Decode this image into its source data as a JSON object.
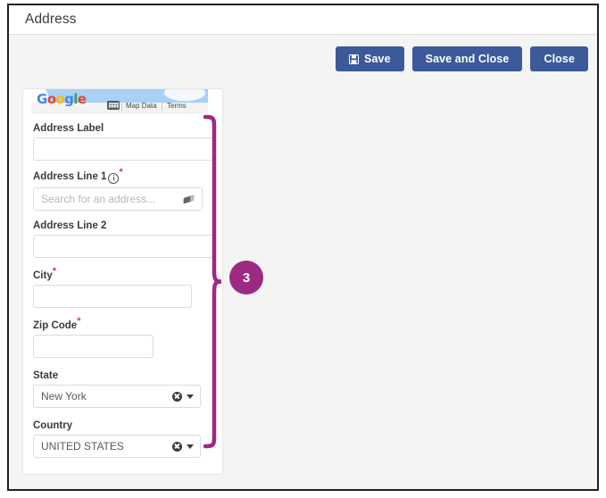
{
  "window": {
    "title": "Address"
  },
  "toolbar": {
    "buttons": [
      {
        "label": "Save",
        "icon": "save-disk-icon"
      },
      {
        "label": "Save and Close",
        "icon": ""
      },
      {
        "label": "Close",
        "icon": ""
      }
    ],
    "color": "#3c5a9a"
  },
  "map": {
    "provider": "Google",
    "logo_letters": [
      "G",
      "o",
      "o",
      "g",
      "l",
      "e"
    ],
    "keyboard_icon": "keyboard-icon",
    "links": [
      "Map Data",
      "Terms"
    ]
  },
  "form": {
    "fields": [
      {
        "label": "Address Label",
        "required": false,
        "info": false,
        "value": "",
        "placeholder": "",
        "control": "text"
      },
      {
        "label": "Address Line 1",
        "required": true,
        "info": true,
        "value": "",
        "placeholder": "Search for an address...",
        "control": "search"
      },
      {
        "label": "Address Line 2",
        "required": false,
        "info": false,
        "value": "",
        "placeholder": "",
        "control": "text"
      },
      {
        "label": "City",
        "required": true,
        "info": false,
        "value": "",
        "placeholder": "",
        "control": "text"
      },
      {
        "label": "Zip Code",
        "required": true,
        "info": false,
        "value": "",
        "placeholder": "",
        "control": "text"
      },
      {
        "label": "State",
        "required": false,
        "info": false,
        "value": "New York",
        "placeholder": "",
        "control": "dropdown"
      },
      {
        "label": "Country",
        "required": false,
        "info": false,
        "value": "UNITED STATES",
        "placeholder": "",
        "control": "dropdown"
      }
    ]
  },
  "annotation": {
    "number": "3",
    "color": "#9c2a82"
  }
}
